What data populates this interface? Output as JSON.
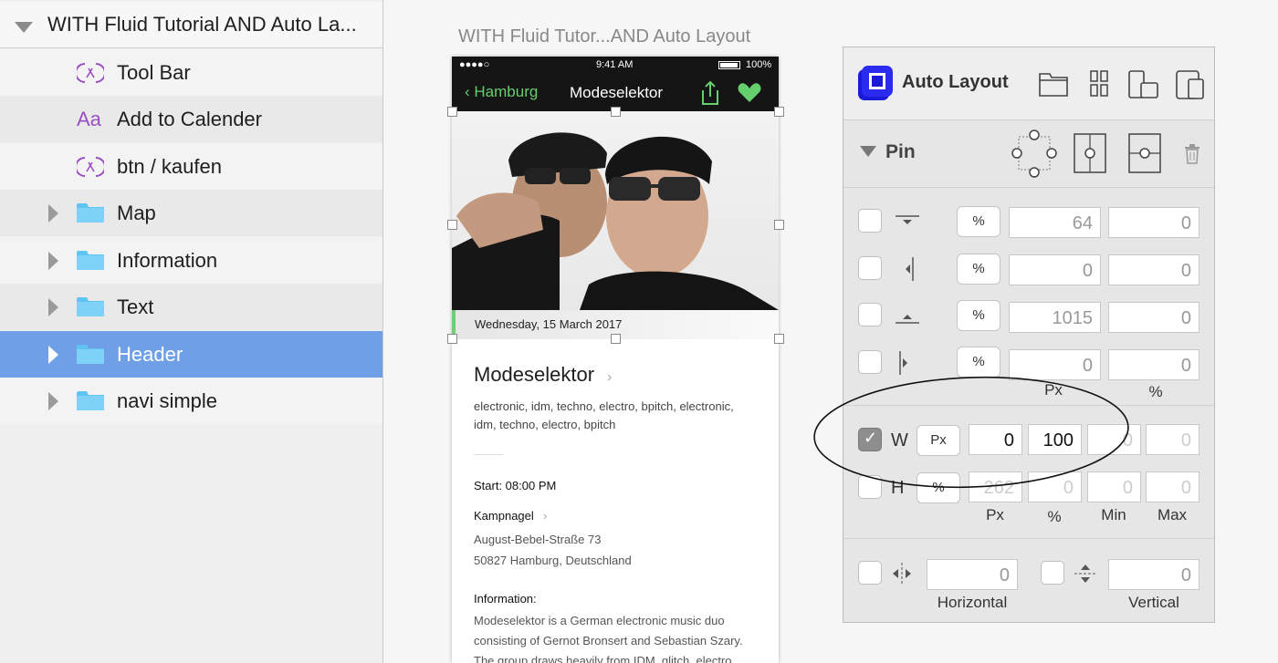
{
  "layers": {
    "items": [
      {
        "label": "WITH Fluid Tutorial AND Auto La...",
        "icon": "triangle-down-icon"
      },
      {
        "label": "Tool Bar",
        "icon": "symbol-icon"
      },
      {
        "label": "Add to Calender",
        "icon": "text-layer-icon",
        "icon_text": "Aa"
      },
      {
        "label": "btn / kaufen",
        "icon": "symbol-icon"
      },
      {
        "label": "Map",
        "icon": "folder-icon"
      },
      {
        "label": "Information",
        "icon": "folder-icon"
      },
      {
        "label": "Text",
        "icon": "folder-icon"
      },
      {
        "label": "Header",
        "icon": "folder-icon",
        "selected": true
      },
      {
        "label": "navi simple",
        "icon": "folder-icon"
      }
    ],
    "selection_color": "#6f9fe6"
  },
  "artboard": {
    "title": "WITH Fluid Tutor...AND Auto Layout",
    "status": {
      "signal": "●●●●○",
      "time": "9:41 AM",
      "battery": "100%"
    },
    "nav": {
      "back": "Hamburg",
      "title": "Modeselektor"
    },
    "date": "Wednesday, 15 March 2017",
    "event_title": "Modeselektor",
    "tags": "electronic, idm, techno, electro, bpitch, electronic, idm, techno, electro, bpitch",
    "start": "Start: 08:00 PM",
    "venue": "Kampnagel",
    "address_line1": "August-Bebel-Straße 73",
    "address_line2": "50827 Hamburg, Deutschland",
    "info_heading": "Information:",
    "info_text": "Modeselektor is a German electronic music duo consisting of Gernot Bronsert and Sebastian Szary. The group draws heavily from IDM, glitch, electro",
    "accent_color": "#65cf6d"
  },
  "panel": {
    "title": "Auto Layout",
    "pin_label": "Pin",
    "pin_rows": [
      {
        "unit": "%",
        "value": "64",
        "second": "0"
      },
      {
        "unit": "%",
        "value": "0",
        "second": "0"
      },
      {
        "unit": "%",
        "value": "1015",
        "second": "0"
      },
      {
        "unit": "%",
        "value": "0",
        "second": "0"
      }
    ],
    "pin_col_px": "Px",
    "pin_col_pct": "%",
    "size": {
      "w_label": "W",
      "w_checked": true,
      "w_unit": "Px",
      "w_px": "0",
      "w_pct": "100",
      "w_min": "0",
      "w_max": "0",
      "h_label": "H",
      "h_unit": "%",
      "h_px": "262",
      "h_pct": "0",
      "h_min": "0",
      "h_max": "0",
      "col_px": "Px",
      "col_pct": "%",
      "col_min": "Min",
      "col_max": "Max"
    },
    "spacing": {
      "horizontal_value": "0",
      "vertical_value": "0",
      "horizontal_label": "Horizontal",
      "vertical_label": "Vertical"
    },
    "logo_color": "#1a1ad8"
  }
}
